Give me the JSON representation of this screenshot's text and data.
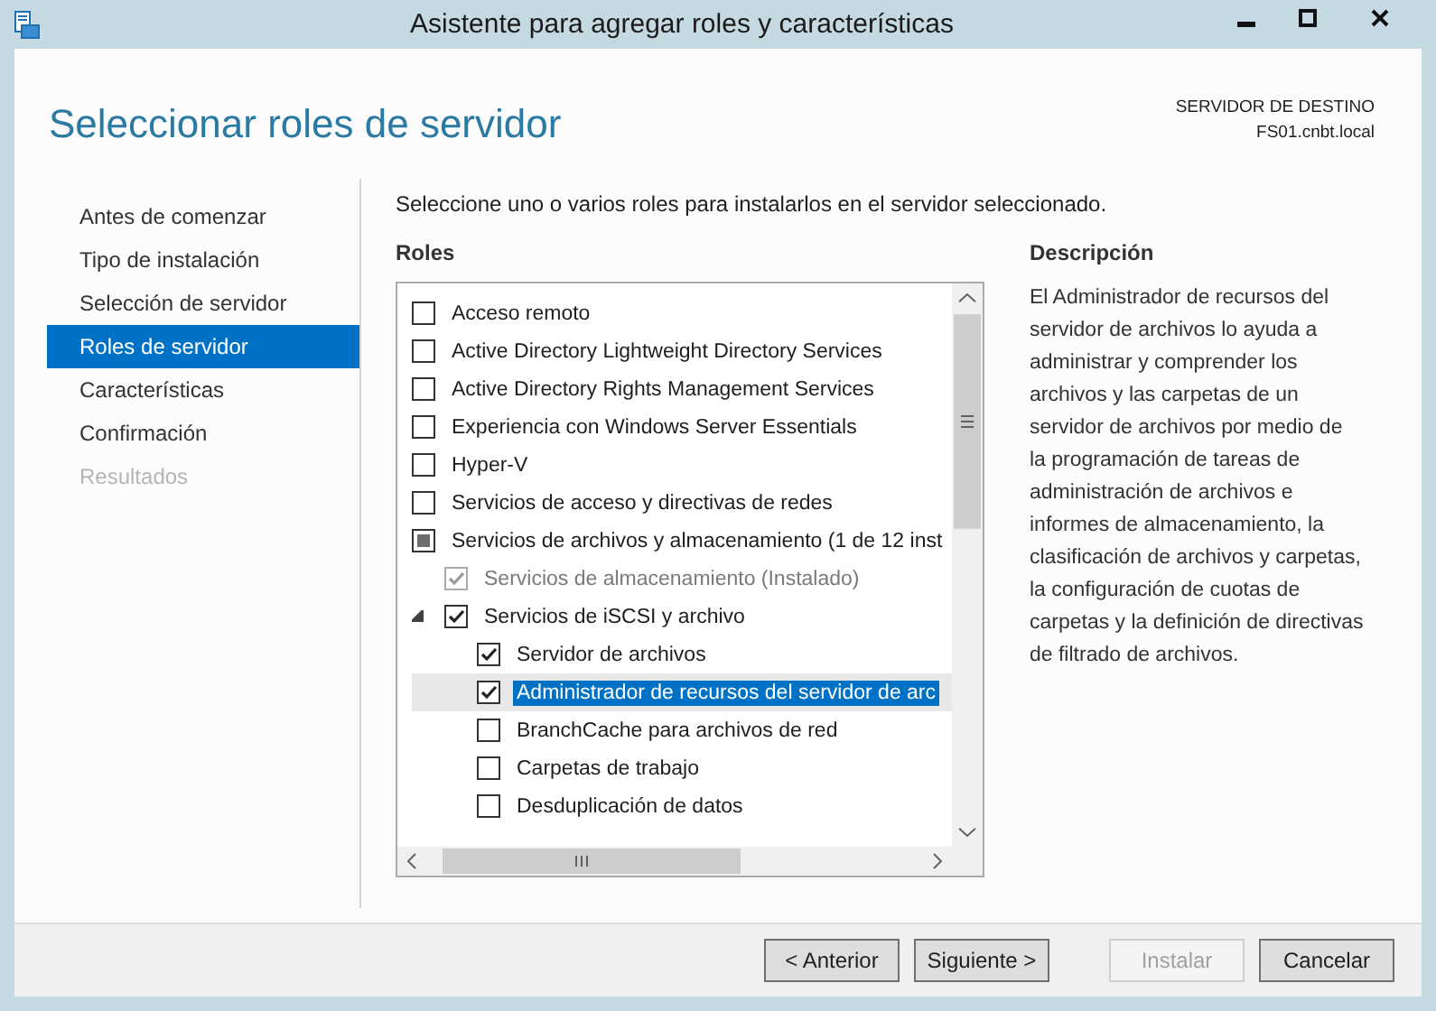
{
  "window": {
    "title": "Asistente para agregar roles y características"
  },
  "header": {
    "title": "Seleccionar roles de servidor",
    "destination_label": "SERVIDOR DE DESTINO",
    "destination_server": "FS01.cnbt.local"
  },
  "sidebar": {
    "items": [
      {
        "label": "Antes de comenzar",
        "selected": false,
        "disabled": false
      },
      {
        "label": "Tipo de instalación",
        "selected": false,
        "disabled": false
      },
      {
        "label": "Selección de servidor",
        "selected": false,
        "disabled": false
      },
      {
        "label": "Roles de servidor",
        "selected": true,
        "disabled": false
      },
      {
        "label": "Características",
        "selected": false,
        "disabled": false
      },
      {
        "label": "Confirmación",
        "selected": false,
        "disabled": false
      },
      {
        "label": "Resultados",
        "selected": false,
        "disabled": true
      }
    ]
  },
  "instruction": "Seleccione uno o varios roles para instalarlos en el servidor seleccionado.",
  "roles": {
    "heading": "Roles",
    "items": [
      {
        "label": "Acceso remoto",
        "checked": false,
        "partial": false,
        "disabled": false,
        "selected": false
      },
      {
        "label": "Active Directory Lightweight Directory Services",
        "checked": false,
        "partial": false,
        "disabled": false,
        "selected": false
      },
      {
        "label": "Active Directory Rights Management Services",
        "checked": false,
        "partial": false,
        "disabled": false,
        "selected": false
      },
      {
        "label": "Experiencia con Windows Server Essentials",
        "checked": false,
        "partial": false,
        "disabled": false,
        "selected": false
      },
      {
        "label": "Hyper-V",
        "checked": false,
        "partial": false,
        "disabled": false,
        "selected": false
      },
      {
        "label": "Servicios de acceso y directivas de redes",
        "checked": false,
        "partial": false,
        "disabled": false,
        "selected": false
      },
      {
        "label": "Servicios de archivos y almacenamiento (1 de 12 inst",
        "checked": false,
        "partial": true,
        "disabled": false,
        "selected": false,
        "children": [
          {
            "label": "Servicios de almacenamiento (Instalado)",
            "checked": true,
            "partial": false,
            "disabled": true,
            "selected": false
          },
          {
            "label": "Servicios de iSCSI y archivo",
            "checked": true,
            "partial": false,
            "disabled": false,
            "selected": false,
            "expanded": true,
            "children": [
              {
                "label": "Servidor de archivos",
                "checked": true,
                "partial": false,
                "disabled": false,
                "selected": false
              },
              {
                "label": "Administrador de recursos del servidor de arc",
                "checked": true,
                "partial": false,
                "disabled": false,
                "selected": true
              },
              {
                "label": "BranchCache para archivos de red",
                "checked": false,
                "partial": false,
                "disabled": false,
                "selected": false
              },
              {
                "label": "Carpetas de trabajo",
                "checked": false,
                "partial": false,
                "disabled": false,
                "selected": false
              },
              {
                "label": "Desduplicación de datos",
                "checked": false,
                "partial": false,
                "disabled": false,
                "selected": false
              }
            ]
          }
        ]
      }
    ]
  },
  "description": {
    "heading": "Descripción",
    "text": "El Administrador de recursos del servidor de archivos lo ayuda a administrar y comprender los archivos y las carpetas de un servidor de archivos por medio de la programación de tareas de administración de archivos e informes de almacenamiento, la clasificación de archivos y carpetas, la configuración de cuotas de carpetas y la definición de directivas de filtrado de archivos."
  },
  "buttons": [
    {
      "label": "< Anterior",
      "disabled": false
    },
    {
      "label": "Siguiente >",
      "disabled": false
    },
    {
      "label": "Instalar",
      "disabled": true
    },
    {
      "label": "Cancelar",
      "disabled": false
    }
  ]
}
